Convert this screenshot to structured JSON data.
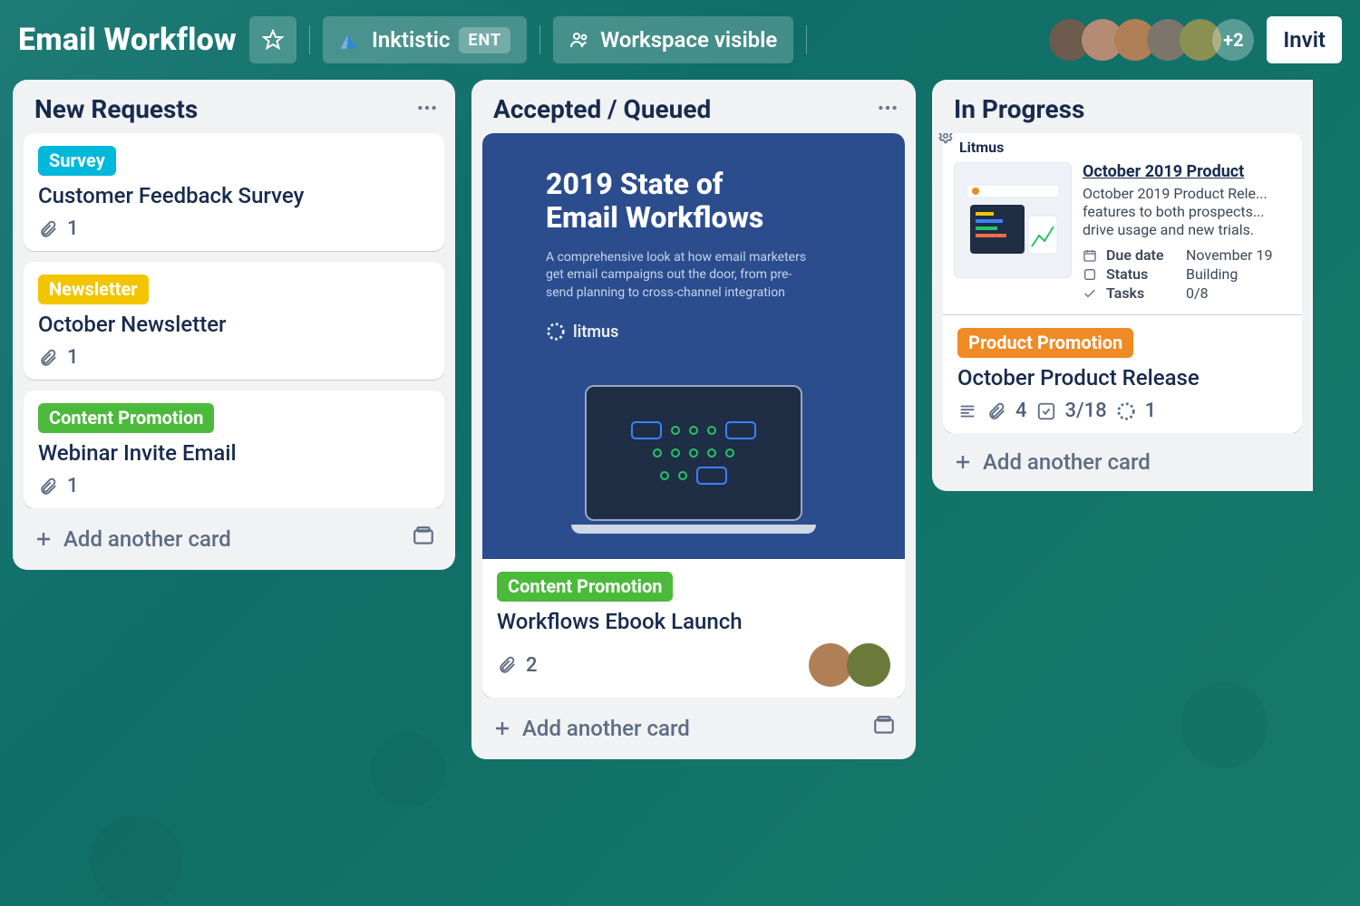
{
  "header": {
    "board_title": "Email Workflow",
    "workspace": "Inktistic",
    "workspace_tier": "ENT",
    "visibility": "Workspace visible",
    "avatar_overflow": "+2",
    "invite_label": "Invit"
  },
  "labels": {
    "survey": {
      "text": "Survey",
      "color": "#00b8d9"
    },
    "newsletter": {
      "text": "Newsletter",
      "color": "#f2c500"
    },
    "content_promotion": {
      "text": "Content Promotion",
      "color": "#4bba3b"
    },
    "product_promotion": {
      "text": "Product Promotion",
      "color": "#f08a24"
    }
  },
  "lists": [
    {
      "title": "New Requests",
      "add_label": "Add another card",
      "cards": [
        {
          "label_key": "survey",
          "title": "Customer Feedback Survey",
          "attachments": 1
        },
        {
          "label_key": "newsletter",
          "title": "October Newsletter",
          "attachments": 1
        },
        {
          "label_key": "content_promotion",
          "title": "Webinar Invite Email",
          "attachments": 1
        }
      ]
    },
    {
      "title": "Accepted / Queued",
      "add_label": "Add another card",
      "cover": {
        "headline_line1": "2019 State of",
        "headline_line2": "Email Workflows",
        "sub": "A comprehensive look at how email marketers get email campaigns out the door, from pre-send planning to cross-channel integration",
        "brand": "litmus"
      },
      "cards": [
        {
          "label_key": "content_promotion",
          "title": "Workflows Ebook Launch",
          "attachments": 2,
          "members": 2
        }
      ]
    },
    {
      "title": "In Progress",
      "add_label": "Add another card",
      "preview": {
        "brand": "Litmus",
        "title": "October 2019 Product",
        "desc": "October 2019 Product Rele... features to both prospects... drive usage and new trials.",
        "due_k": "Due date",
        "due_v": "November 19",
        "status_k": "Status",
        "status_v": "Building",
        "tasks_k": "Tasks",
        "tasks_v": "0/8"
      },
      "cards": [
        {
          "label_key": "product_promotion",
          "title": "October Product Release",
          "attachments": 4,
          "checklist": "3/18",
          "stickers": 1,
          "has_desc": true
        }
      ]
    }
  ],
  "avatar_colors": [
    "#6d5b4e",
    "#b58b73",
    "#b07f55",
    "#7c756c",
    "#8a8f52"
  ]
}
